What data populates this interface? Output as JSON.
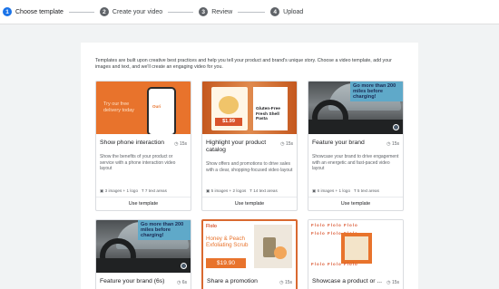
{
  "steps": [
    {
      "num": "1",
      "label": "Choose template"
    },
    {
      "num": "2",
      "label": "Create your video"
    },
    {
      "num": "3",
      "label": "Review"
    },
    {
      "num": "4",
      "label": "Upload"
    }
  ],
  "intro": "Templates are built upon creative best practices and help you tell your product and brand's unique story. Choose a video template, add your images and text, and we'll create an engaging video for you.",
  "cards": [
    {
      "title": "Show phone interaction",
      "duration": "15s",
      "description": "Show the benefits of your product or service with a phone interaction video layout",
      "meta_images": "3 images + 1 logo",
      "meta_text": "7 text areas",
      "button": "Use template",
      "thumb_text": "Try our free delivery today",
      "brand_label": "Ouri"
    },
    {
      "title": "Highlight your product catalog",
      "duration": "15s",
      "description": "Show offers and promotions to drive sales with a clear, shopping-focused video layout",
      "meta_images": "5 images + 2 logos",
      "meta_text": "14 text areas",
      "button": "Use template",
      "product_text": "Gluten-Free Fresh Shell Pasta",
      "price": "$1.99"
    },
    {
      "title": "Feature your brand",
      "duration": "15s",
      "description": "Showcase your brand to drive engagement with an energetic and fast-paced video layout",
      "meta_images": "6 images + 1 logo",
      "meta_text": "5 text areas",
      "button": "Use template",
      "banner": "Go more than 200 miles before charging!"
    },
    {
      "title": "Feature your brand (6s)",
      "duration": "6s",
      "banner": "Go more than 200 miles before charging!"
    },
    {
      "title": "Share a promotion",
      "duration": "15s",
      "brand": "Flolo",
      "product": "Honey & Peach Exfoliating Scrub",
      "price": "$19.90"
    },
    {
      "title": "Showcase a product or ...",
      "duration": "15s",
      "brand": "Flolo"
    }
  ]
}
